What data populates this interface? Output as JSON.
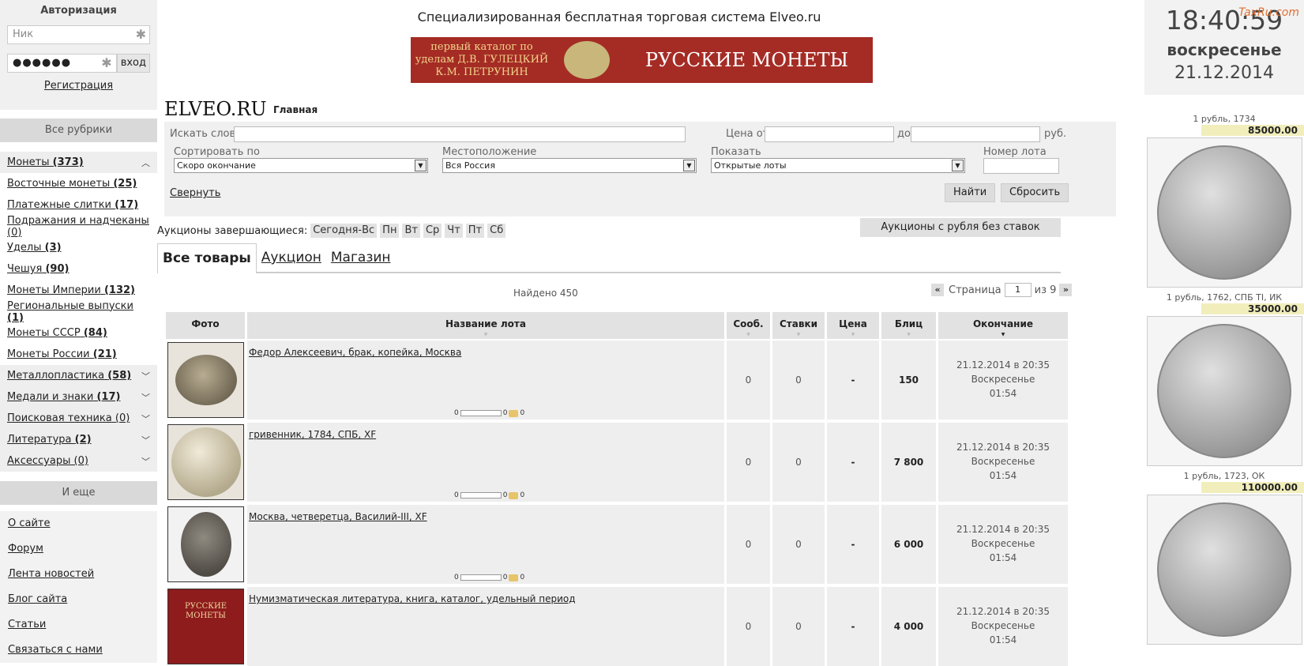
{
  "auth": {
    "title": "Авторизация",
    "nick_placeholder": "Ник",
    "password_value": "●●●●●●",
    "login_button": "вход",
    "register_link": "Регистрация"
  },
  "rubrics": {
    "title": "Все рубрики",
    "items": [
      {
        "label": "Монеты",
        "count": "(373)"
      },
      {
        "label": "Восточные монеты",
        "count": "(25)"
      },
      {
        "label": "Платежные слитки",
        "count": "(17)"
      },
      {
        "label": "Подражания и надчеканы",
        "count": "(0)"
      },
      {
        "label": "Уделы",
        "count": "(3)"
      },
      {
        "label": "Чешуя",
        "count": "(90)"
      },
      {
        "label": "Монеты Империи",
        "count": "(132)"
      },
      {
        "label": "Региональные выпуски",
        "count": "(1)"
      },
      {
        "label": "Монеты СССР",
        "count": "(84)"
      },
      {
        "label": "Монеты России",
        "count": "(21)"
      },
      {
        "label": "Металлопластика",
        "count": "(58)"
      },
      {
        "label": "Медали и знаки",
        "count": "(17)"
      },
      {
        "label": "Поисковая техника",
        "count": "(0)"
      },
      {
        "label": "Литература",
        "count": "(2)"
      },
      {
        "label": "Аксессуары",
        "count": "(0)"
      }
    ]
  },
  "more": {
    "title": "И еще",
    "links": [
      "О сайте",
      "Форум",
      "Лента новостей",
      "Блог сайта",
      "Статьи",
      "Связаться с нами"
    ]
  },
  "header": {
    "slogan": "Специализированная бесплатная торговая система Elveo.ru",
    "banner_left": "первый каталог по уделам Д.В. ГУЛЕЦКИЙ К.М. ПЕТРУНИН",
    "banner_right": "РУССКИЕ МОНЕТЫ",
    "logo": "ELVEO.RU",
    "breadcrumb": "Главная"
  },
  "filter": {
    "search_label": "Искать слова",
    "price_from": "Цена от",
    "price_to": "до",
    "currency": "руб.",
    "sort_label": "Сортировать по",
    "sort_value": "Скоро окончание",
    "location_label": "Местоположение",
    "location_value": "Вся Россия",
    "show_label": "Показать",
    "show_value": "Открытые лоты",
    "lot_number_label": "Номер лота",
    "collapse_link": "Свернуть",
    "find_button": "Найти",
    "reset_button": "Сбросить"
  },
  "ending": {
    "label": "Аукционы завершающиеся:",
    "days": [
      "Сегодня-Вс",
      "Пн",
      "Вт",
      "Ср",
      "Чт",
      "Пт",
      "Сб"
    ],
    "no_bids_button": "Аукционы с рубля без ставок"
  },
  "tabs": [
    "Все товары",
    "Аукцион",
    "Магазин"
  ],
  "results": {
    "found": "Найдено 450",
    "page_label": "Страница",
    "page_value": "1",
    "page_of": "из 9"
  },
  "table": {
    "headers": [
      "Фото",
      "Название лота",
      "Сооб.",
      "Ставки",
      "Цена",
      "Блиц",
      "Окончание"
    ],
    "rows": [
      {
        "title": "Федор Алексеевич, брак, копейка, Москва",
        "msgs": "0",
        "bids": "0",
        "price": "-",
        "blitz": "150",
        "end_date": "21.12.2014 в 20:35",
        "end_day": "Воскресенье",
        "end_left": "01:54"
      },
      {
        "title": "гривенник, 1784, СПБ, XF",
        "msgs": "0",
        "bids": "0",
        "price": "-",
        "blitz": "7 800",
        "end_date": "21.12.2014 в 20:35",
        "end_day": "Воскресенье",
        "end_left": "01:54"
      },
      {
        "title": "Москва, четверетца, Василий-III, XF",
        "msgs": "0",
        "bids": "0",
        "price": "-",
        "blitz": "6 000",
        "end_date": "21.12.2014 в 20:35",
        "end_day": "Воскресенье",
        "end_left": "01:54"
      },
      {
        "title": "Нумизматическая литература, книга, каталог, удельный период",
        "msgs": "0",
        "bids": "0",
        "price": "-",
        "blitz": "4 000",
        "end_date": "21.12.2014 в 20:35",
        "end_day": "Воскресенье",
        "end_left": "01:54"
      }
    ],
    "meter_left": "0",
    "meter_mid": "0",
    "meter_right": "0",
    "book_cover_text": "РУССКИЕ МОНЕТЫ"
  },
  "clock": {
    "time": "18:40:59",
    "weekday": "воскресенье",
    "date": "21.12.2014",
    "watermark": "TaxRu.com"
  },
  "featured": [
    {
      "caption": "1 рубль, 1734",
      "price": "85000.00"
    },
    {
      "caption": "1 рубль, 1762, СПБ TI, ИК",
      "price": "35000.00"
    },
    {
      "caption": "1 рубль, 1723, ОК",
      "price": "110000.00"
    }
  ]
}
